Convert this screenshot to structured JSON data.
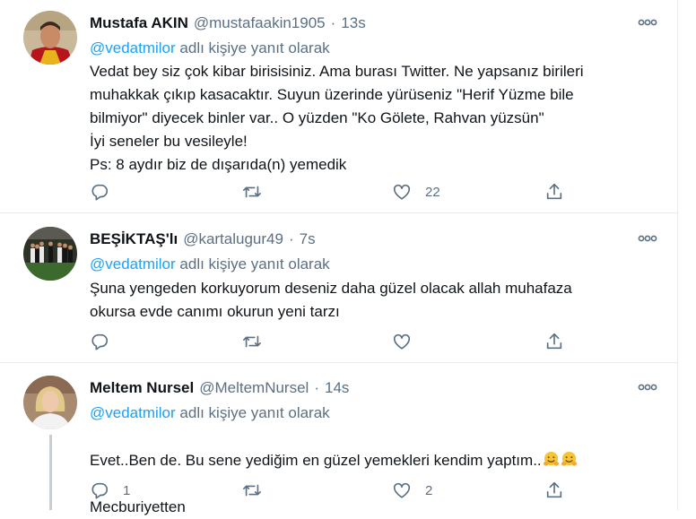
{
  "tweets": [
    {
      "name": "Mustafa AKIN",
      "handle": "@mustafaakin1905",
      "separator": "·",
      "time": "13s",
      "reply_mention": "@vedatmilor",
      "reply_text": "adlı kişiye yanıt olarak",
      "body": "Vedat bey siz çok kibar birisisiniz. Ama burası Twitter. Ne yapsanız birileri\nmuhakkak çıkıp kasacaktır. Suyun üzerinde yürüseniz \"Herif Yüzme bile\nbilmiyor\" diyecek binler var.. O yüzden \"Ko Gölete, Rahvan yüzsün\"\nİyi seneler bu vesileyle!\nPs: 8 aydır biz de  dışarıda(n) yemedik",
      "reply_count": "",
      "retweet_count": "",
      "like_count": "22"
    },
    {
      "name": "BEŞİKTAŞ'lı",
      "handle": "@kartalugur49",
      "separator": "·",
      "time": "7s",
      "reply_mention": "@vedatmilor",
      "reply_text": "adlı kişiye yanıt olarak",
      "body": "Şuna yengeden korkuyorum deseniz daha güzel olacak allah muhafaza\nokursa evde canımı okurun yeni tarzı",
      "reply_count": "",
      "retweet_count": "",
      "like_count": ""
    },
    {
      "name": "Meltem Nursel",
      "handle": "@MeltemNursel",
      "separator": "·",
      "time": "14s",
      "reply_mention": "@vedatmilor",
      "reply_text": "adlı kişiye yanıt olarak",
      "body_line1": "Evet..Ben de. Bu sene  yediğim en güzel yemekleri kendim yaptım..",
      "body_line2": "Mecburiyetten",
      "reply_count": "1",
      "retweet_count": "",
      "like_count": "2"
    }
  ],
  "icons": [
    "reply-icon",
    "retweet-icon",
    "like-icon",
    "share-icon",
    "more-icon",
    "hugging-face-emoji"
  ],
  "colors": {
    "link": "#1da1f2",
    "secondary": "#5b7083",
    "text": "#0f1419",
    "border": "#e6ecf0"
  }
}
